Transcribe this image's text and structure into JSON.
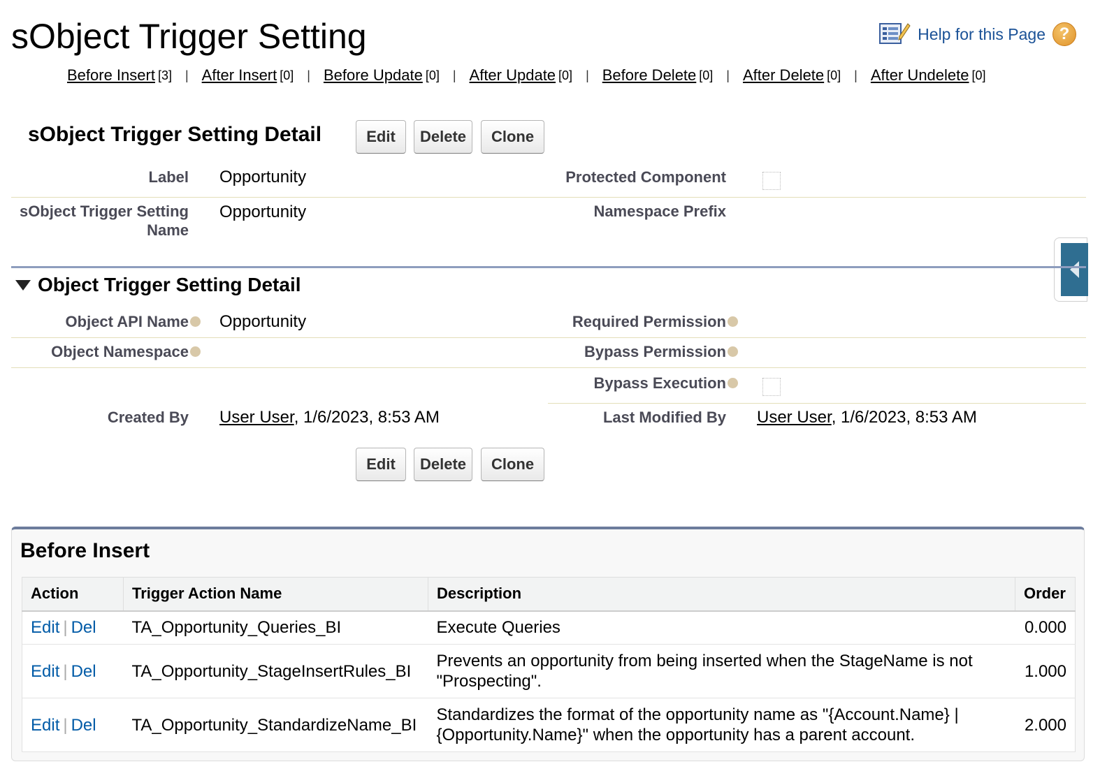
{
  "page": {
    "title": "sObject Trigger Setting"
  },
  "help": {
    "link": "Help for this Page"
  },
  "related_links": [
    {
      "label": "Before Insert",
      "count": "[3]"
    },
    {
      "label": "After Insert",
      "count": "[0]"
    },
    {
      "label": "Before Update",
      "count": "[0]"
    },
    {
      "label": "After Update",
      "count": "[0]"
    },
    {
      "label": "Before Delete",
      "count": "[0]"
    },
    {
      "label": "After Delete",
      "count": "[0]"
    },
    {
      "label": "After Undelete",
      "count": "[0]"
    }
  ],
  "detail": {
    "title": "sObject Trigger Setting Detail",
    "buttons": {
      "edit": "Edit",
      "delete": "Delete",
      "clone": "Clone"
    },
    "fields": {
      "label": {
        "label": "Label",
        "value": "Opportunity"
      },
      "setting_name": {
        "label": "sObject Trigger Setting Name",
        "value": "Opportunity"
      },
      "protected_component": {
        "label": "Protected Component",
        "checked": false
      },
      "namespace_prefix": {
        "label": "Namespace Prefix",
        "value": ""
      }
    }
  },
  "object_section": {
    "title": "Object Trigger Setting Detail",
    "fields": {
      "object_api_name": {
        "label": "Object API Name",
        "value": "Opportunity"
      },
      "object_namespace": {
        "label": "Object Namespace",
        "value": ""
      },
      "required_permission": {
        "label": "Required Permission",
        "value": ""
      },
      "bypass_permission": {
        "label": "Bypass Permission",
        "value": ""
      },
      "bypass_execution": {
        "label": "Bypass Execution",
        "checked": false
      }
    }
  },
  "audit": {
    "created_by": {
      "label": "Created By",
      "user": "User User",
      "date": ", 1/6/2023, 8:53 AM"
    },
    "last_modified_by": {
      "label": "Last Modified By",
      "user": "User User",
      "date": ", 1/6/2023, 8:53 AM"
    }
  },
  "related_list": {
    "title": "Before Insert",
    "columns": [
      "Action",
      "Trigger Action Name",
      "Description",
      "Order"
    ],
    "action_edit": "Edit",
    "action_sep": "|",
    "action_del": "Del",
    "rows": [
      {
        "name": "TA_Opportunity_Queries_BI",
        "description": "Execute Queries",
        "order": "0.000"
      },
      {
        "name": "TA_Opportunity_StageInsertRules_BI",
        "description": "Prevents an opportunity from being inserted when the StageName is not \"Prospecting\".",
        "order": "1.000"
      },
      {
        "name": "TA_Opportunity_StandardizeName_BI",
        "description": "Standardizes the format of the opportunity name as \"{Account.Name} | {Opportunity.Name}\" when the opportunity has a parent account.",
        "order": "2.000"
      }
    ]
  },
  "colors": {
    "link_blue": "#015ba7",
    "help_blue": "#1b5297",
    "section_bar": "#8e9dbe",
    "side_tab": "#2f6e91"
  },
  "icons": [
    "help-doc-icon",
    "help-question-icon",
    "collapse-triangle-icon",
    "info-icon",
    "sidebar-toggle-icon"
  ]
}
